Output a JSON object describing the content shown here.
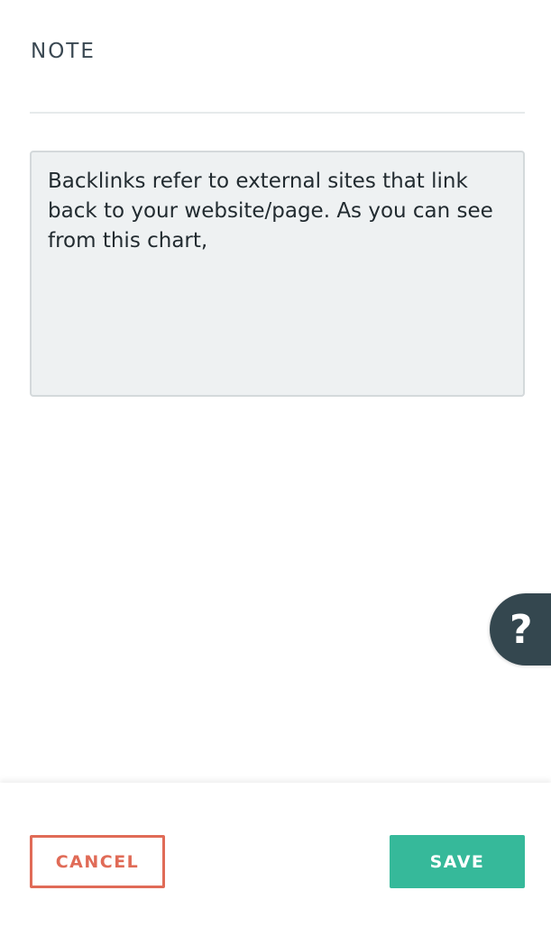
{
  "note": {
    "heading": "NOTE",
    "text": "Backlinks refer to external sites that link back to your website/page. As you can see from this chart,"
  },
  "help": {
    "icon": "question-icon",
    "glyph": "?"
  },
  "footer": {
    "cancel_label": "CANCEL",
    "save_label": "SAVE"
  },
  "colors": {
    "cancel": "#e06b57",
    "save": "#36b99a",
    "help_tab": "#34474f",
    "note_bg": "#eef1f2"
  }
}
